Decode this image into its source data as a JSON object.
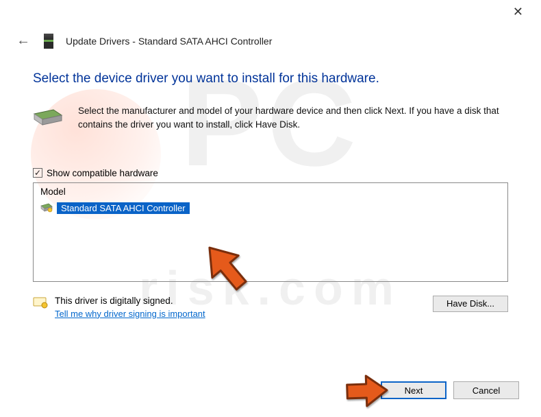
{
  "window": {
    "title_prefix": "Update Drivers - ",
    "device_name": "Standard SATA AHCI Controller"
  },
  "subtitle": "Select the device driver you want to install for this hardware.",
  "info_text": "Select the manufacturer and model of your hardware device and then click Next. If you have a disk that contains the driver you want to install, click Have Disk.",
  "checkbox": {
    "label": "Show compatible hardware",
    "checked_glyph": "✓"
  },
  "list": {
    "header": "Model",
    "items": [
      {
        "label": "Standard SATA AHCI Controller",
        "selected": true
      }
    ]
  },
  "signing": {
    "text": "This driver is digitally signed.",
    "link": "Tell me why driver signing is important"
  },
  "buttons": {
    "have_disk": "Have Disk...",
    "next": "Next",
    "cancel": "Cancel"
  },
  "close_glyph": "✕",
  "back_glyph": "←"
}
